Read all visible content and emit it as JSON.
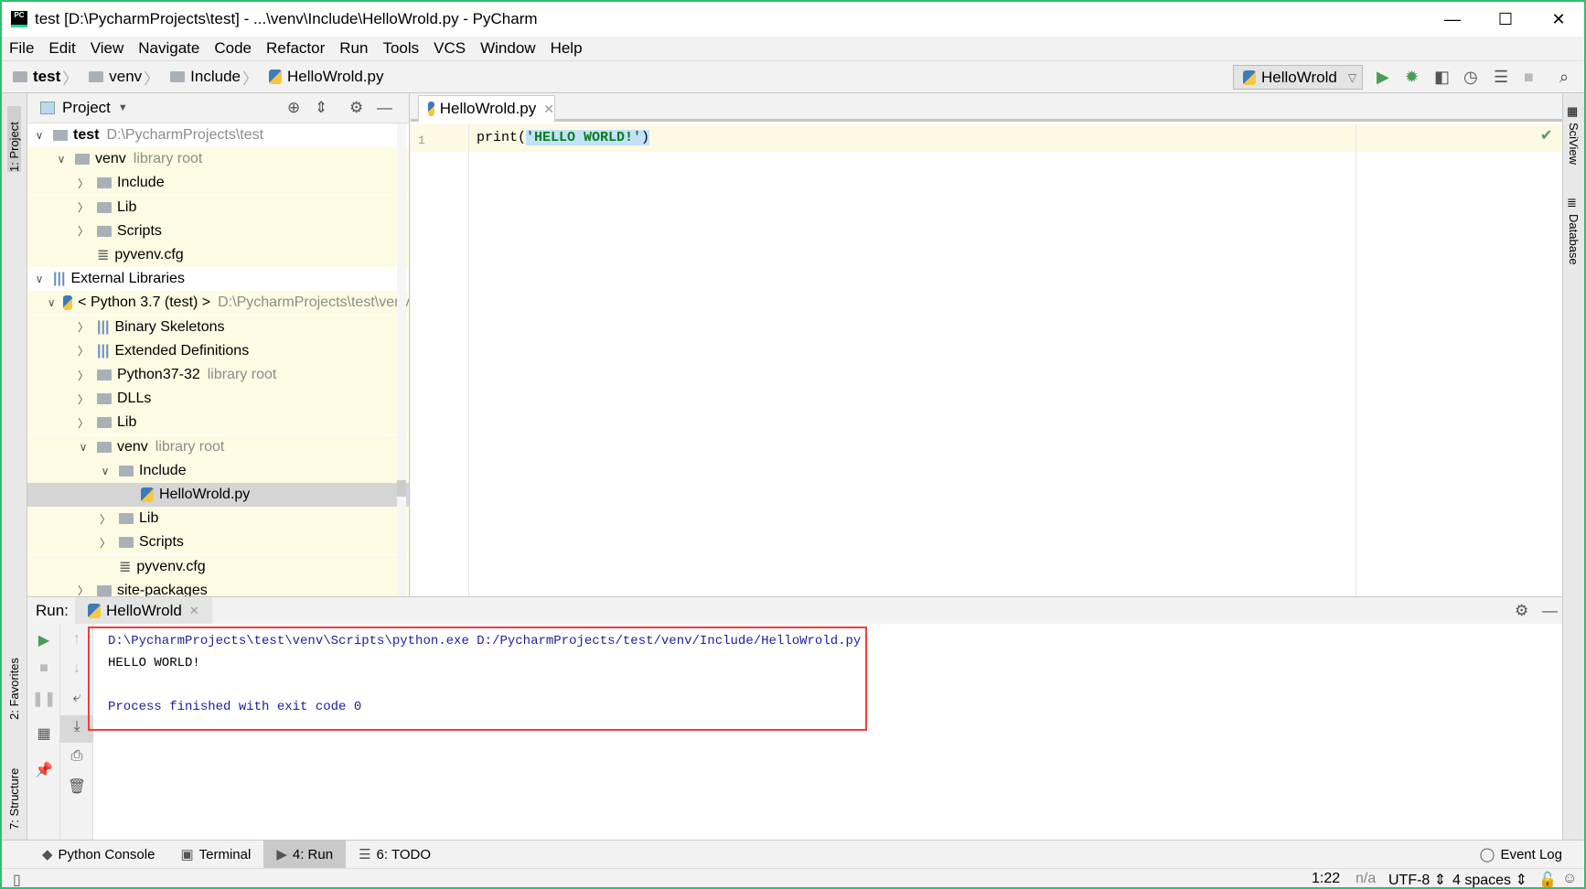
{
  "window": {
    "title": "test [D:\\PycharmProjects\\test] - ...\\venv\\Include\\HelloWrold.py - PyCharm",
    "logo": "PC",
    "minimize": "—",
    "maximize": "☐",
    "close": "✕"
  },
  "menu": [
    "File",
    "Edit",
    "View",
    "Navigate",
    "Code",
    "Refactor",
    "Run",
    "Tools",
    "VCS",
    "Window",
    "Help"
  ],
  "breadcrumb": [
    "test",
    "venv",
    "Include",
    "HelloWrold.py"
  ],
  "toolbar": {
    "run_config": "HelloWrold",
    "icons": [
      "run-icon",
      "debug-icon",
      "coverage-icon",
      "profile-icon",
      "concurrency-icon",
      "stop-icon",
      "search-icon"
    ]
  },
  "left_stripe": {
    "project": "1: Project",
    "favorites": "2: Favorites",
    "structure": "7: Structure"
  },
  "right_stripe": {
    "sciview": "SciView",
    "database": "Database"
  },
  "project": {
    "title": "Project",
    "tree": [
      {
        "label": "test",
        "hint": "D:\\PycharmProjects\\test",
        "depth": 0,
        "arrow": "expanded",
        "icon": "folder",
        "bold": true
      },
      {
        "label": "venv",
        "hint": "library root",
        "depth": 1,
        "arrow": "expanded",
        "icon": "folder"
      },
      {
        "label": "Include",
        "depth": 2,
        "arrow": "collapsed",
        "icon": "folder"
      },
      {
        "label": "Lib",
        "depth": 2,
        "arrow": "collapsed",
        "icon": "folder"
      },
      {
        "label": "Scripts",
        "depth": 2,
        "arrow": "collapsed",
        "icon": "folder"
      },
      {
        "label": "pyvenv.cfg",
        "depth": 2,
        "arrow": "none",
        "icon": "file"
      },
      {
        "label": "External Libraries",
        "depth": 0,
        "arrow": "expanded",
        "icon": "library"
      },
      {
        "label": "< Python 3.7 (test) >",
        "hint": "D:\\PycharmProjects\\test\\venv",
        "depth": 1,
        "arrow": "expanded",
        "icon": "python"
      },
      {
        "label": "Binary Skeletons",
        "depth": 2,
        "arrow": "collapsed",
        "icon": "library"
      },
      {
        "label": "Extended Definitions",
        "depth": 2,
        "arrow": "collapsed",
        "icon": "library"
      },
      {
        "label": "Python37-32",
        "hint": "library root",
        "depth": 2,
        "arrow": "collapsed",
        "icon": "folder"
      },
      {
        "label": "DLLs",
        "depth": 2,
        "arrow": "collapsed",
        "icon": "folder"
      },
      {
        "label": "Lib",
        "depth": 2,
        "arrow": "collapsed",
        "icon": "folder"
      },
      {
        "label": "venv",
        "hint": "library root",
        "depth": 2,
        "arrow": "expanded",
        "icon": "folder"
      },
      {
        "label": "Include",
        "depth": 3,
        "arrow": "expanded",
        "icon": "folder"
      },
      {
        "label": "HelloWrold.py",
        "depth": 4,
        "arrow": "none",
        "icon": "python",
        "selected": true
      },
      {
        "label": "Lib",
        "depth": 3,
        "arrow": "collapsed",
        "icon": "folder"
      },
      {
        "label": "Scripts",
        "depth": 3,
        "arrow": "collapsed",
        "icon": "folder"
      },
      {
        "label": "pyvenv.cfg",
        "depth": 3,
        "arrow": "none",
        "icon": "file"
      },
      {
        "label": "site-packages",
        "depth": 2,
        "arrow": "collapsed",
        "icon": "folder"
      }
    ]
  },
  "editor": {
    "tab": "HelloWrold.py",
    "line_number": "1",
    "code_fn": "print(",
    "code_str": "'HELLO WORLD!'",
    "code_end": ")"
  },
  "run": {
    "label": "Run:",
    "tab": "HelloWrold",
    "output": [
      "D:\\PycharmProjects\\test\\venv\\Scripts\\python.exe D:/PycharmProjects/test/venv/Include/HelloWrold.py",
      "HELLO WORLD!",
      "",
      "Process finished with exit code 0"
    ],
    "colors": {
      "system": "#1d1d9b",
      "stdout": "#000000",
      "highlight_box": "#f03d3d"
    }
  },
  "bottom_tabs": [
    "Python Console",
    "Terminal",
    "4: Run",
    "6: TODO"
  ],
  "event_log": "Event Log",
  "status": {
    "position": "1:22",
    "na": "n/a",
    "encoding": "UTF-8",
    "indent": "4 spaces"
  }
}
